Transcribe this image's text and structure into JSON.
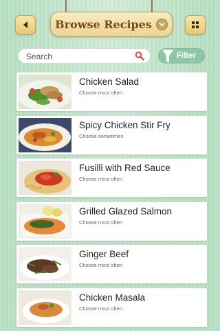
{
  "header": {
    "title": "Browse Recipes",
    "back_icon": "back-arrow-icon",
    "menu_icon": "grid-icon"
  },
  "search": {
    "placeholder": "Search",
    "value": ""
  },
  "filter": {
    "label": "Filter"
  },
  "colors": {
    "background": "#bfe3c8",
    "filter_green": "#8ec6a8",
    "title_brown": "#7a4a1f",
    "search_icon_red": "#e04a3a"
  },
  "recipes": [
    {
      "name": "Chicken Salad",
      "frequency": "Choose most often"
    },
    {
      "name": "Spicy Chicken Stir Fry",
      "frequency": "Choose sometimes"
    },
    {
      "name": "Fusilli with Red Sauce",
      "frequency": "Choose most often"
    },
    {
      "name": "Grilled Glazed Salmon",
      "frequency": "Choose most often"
    },
    {
      "name": "Ginger Beef",
      "frequency": "Choose most often"
    },
    {
      "name": "Chicken Masala",
      "frequency": "Choose most often"
    }
  ]
}
